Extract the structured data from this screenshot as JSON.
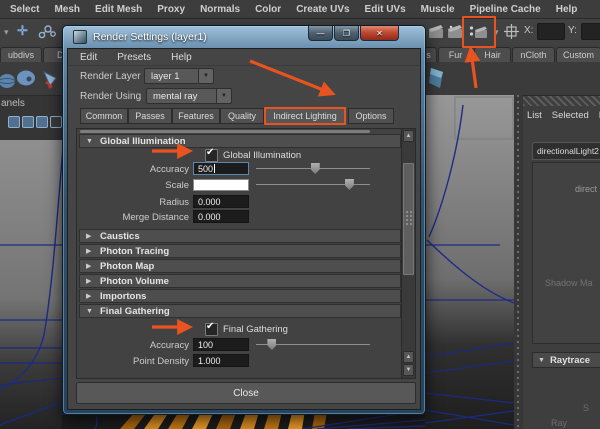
{
  "glyphs": {
    "expanded": "▼",
    "collapsed": "▶",
    "dropdown": "▼",
    "check": "✔",
    "scroll_up": "▲",
    "scroll_down": "▼",
    "chevron": "▾"
  },
  "colors": {
    "accent_orange": "#e8531f",
    "focus_blue": "#5d87ad",
    "wire_navy": "#1d2c85",
    "slat_orange": "#d98a1a"
  },
  "menubar": {
    "items": [
      "Select",
      "Mesh",
      "Edit Mesh",
      "Proxy",
      "Normals",
      "Color",
      "Create UVs",
      "Edit UVs",
      "Muscle",
      "Pipeline Cache",
      "Help"
    ]
  },
  "toolbar": {
    "x_label": "X:",
    "x_value": "",
    "y_label": "Y:",
    "y_value": ""
  },
  "shelf": {
    "left_tabs": [
      "ubdivs",
      "Defor"
    ],
    "right_tabs": [
      "s",
      "Fur",
      "Hair",
      "nCloth",
      "Custom"
    ],
    "panels_label": "anels"
  },
  "dialog": {
    "title": "Render Settings (layer1)",
    "window_buttons": {
      "minimize": "—",
      "maximize": "❐",
      "close": "✕"
    },
    "menu": [
      "Edit",
      "Presets",
      "Help"
    ],
    "render_layer": {
      "label": "Render Layer",
      "value": "layer 1"
    },
    "render_using": {
      "label": "Render Using",
      "value": "mental ray"
    },
    "tabs": [
      "Common",
      "Passes",
      "Features",
      "Quality",
      "Indirect Lighting",
      "Options"
    ],
    "active_tab": "Indirect Lighting",
    "gi": {
      "header": "Global Illumination",
      "checkbox_label": "Global Illumination",
      "checked": true,
      "accuracy_label": "Accuracy",
      "accuracy_value": "500",
      "scale_label": "Scale",
      "scale_swatch": "#ffffff",
      "radius_label": "Radius",
      "radius_value": "0.000",
      "merge_label": "Merge Distance",
      "merge_value": "0.000"
    },
    "collapsed_sections": [
      "Caustics",
      "Photon Tracing",
      "Photon Map",
      "Photon Volume",
      "Importons"
    ],
    "fg": {
      "header": "Final Gathering",
      "checkbox_label": "Final Gathering",
      "checked": true,
      "accuracy_label": "Accuracy",
      "accuracy_value": "100",
      "density_label": "Point Density",
      "density_value": "1.000"
    },
    "close_label": "Close"
  },
  "right_panel": {
    "menu": [
      "List",
      "Selected",
      "F"
    ],
    "tab": "directionalLight2",
    "partial_label": "direct",
    "faded_label": "Shadow Ma",
    "raytrace_header": "Raytrace",
    "faint_labels": [
      "S",
      "Ray"
    ]
  }
}
